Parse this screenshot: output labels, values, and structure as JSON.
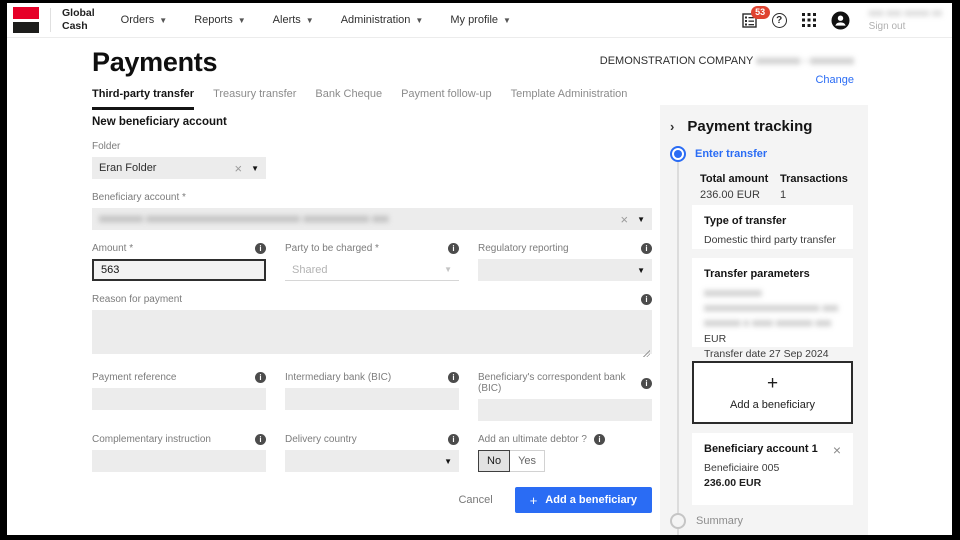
{
  "topbar": {
    "brand_line1": "Global",
    "brand_line2": "Cash",
    "nav": [
      {
        "label": "Orders"
      },
      {
        "label": "Reports"
      },
      {
        "label": "Alerts"
      },
      {
        "label": "Administration"
      },
      {
        "label": "My profile"
      }
    ],
    "notification_count": "53",
    "user_name_redacted": "xxx xxx xxxxx xx",
    "signout_label": "Sign out"
  },
  "header": {
    "title": "Payments",
    "company": "DEMONSTRATION COMPANY",
    "company_ids_redacted": "xxxxxxxx - xxxxxxxx",
    "change_link": "Change"
  },
  "tabs": [
    {
      "label": "Third-party transfer",
      "active": true
    },
    {
      "label": "Treasury transfer",
      "active": false
    },
    {
      "label": "Bank Cheque",
      "active": false
    },
    {
      "label": "Payment follow-up",
      "active": false
    },
    {
      "label": "Template Administration",
      "active": false
    }
  ],
  "form": {
    "section_title": "New beneficiary account",
    "folder": {
      "label": "Folder",
      "value": "Eran Folder"
    },
    "beneficiary_account": {
      "label": "Beneficiary account *",
      "value_redacted": "xxxxxxxx xxxxxxxxxxxxxxxxxxxxxxxxxxxx xxxxxxxxxxxx xxx"
    },
    "amount": {
      "label": "Amount *",
      "value": "563"
    },
    "party_to_be_charged": {
      "label": "Party to be charged *",
      "value": "Shared"
    },
    "regulatory_reporting": {
      "label": "Regulatory reporting",
      "value": ""
    },
    "reason_for_payment": {
      "label": "Reason for payment",
      "value": ""
    },
    "payment_reference": {
      "label": "Payment reference",
      "value": ""
    },
    "intermediary_bank": {
      "label": "Intermediary bank (BIC)",
      "value": ""
    },
    "beneficiary_correspondent_bank": {
      "label": "Beneficiary's correspondent bank (BIC)",
      "value": ""
    },
    "complementary_instruction": {
      "label": "Complementary instruction",
      "value": ""
    },
    "delivery_country": {
      "label": "Delivery country",
      "value": ""
    },
    "ultimate_debtor": {
      "label": "Add an ultimate debtor ?",
      "option_no": "No",
      "option_yes": "Yes",
      "selected": "No"
    },
    "cancel_label": "Cancel",
    "submit_label": "Add a beneficiary"
  },
  "tracking": {
    "title": "Payment tracking",
    "steps": [
      {
        "label": "Enter transfer",
        "state": "active"
      },
      {
        "label": "Summary",
        "state": "upcoming"
      }
    ],
    "total_amount": {
      "label": "Total amount",
      "value": "236.00 EUR"
    },
    "transactions": {
      "label": "Transactions",
      "value": "1"
    },
    "type_of_transfer": {
      "label": "Type of transfer",
      "value": "Domestic third party transfer"
    },
    "transfer_parameters": {
      "label": "Transfer parameters",
      "redacted_lines": [
        "xxxxxxxxxxx",
        "xxxxxxxxxxxxxxxxxxxxxx xxx",
        "xxxxxxx x xxxx xxxxxxx xxx"
      ],
      "currency": "EUR",
      "transfer_date": "Transfer date 27 Sep 2024"
    },
    "add_beneficiary_label": "Add a beneficiary",
    "beneficiary_card": {
      "title": "Beneficiary account 1",
      "name": "Beneficiaire 005",
      "amount": "236.00 EUR"
    }
  },
  "colors": {
    "accent_blue": "#2a6cf4",
    "brand_red": "#e60028",
    "badge_red": "#df4330",
    "field_grey": "#ececec",
    "panel_grey": "#f4f4f4"
  }
}
